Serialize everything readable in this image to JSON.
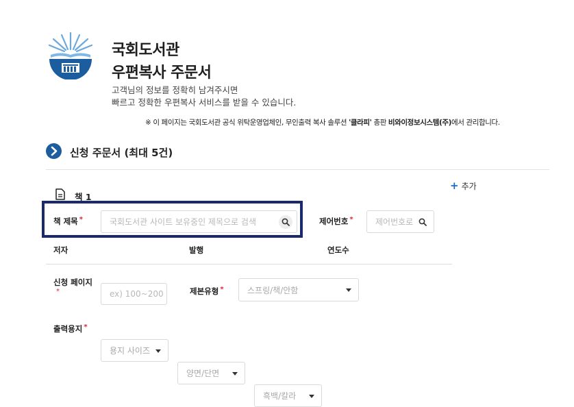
{
  "header": {
    "title_line1": "국회도서관",
    "title_line2": "우편복사 주문서",
    "desc_line1": "고객님의 정보를 정확히 남겨주시면",
    "desc_line2": "빠르고 정확한 우편복사 서비스를 받을 수 있습니다."
  },
  "notice": {
    "mark": "※",
    "text_a": "이 페이지는 국회도서관 공식 위탁운영업체인, 무인출력 복사 솔루션 ",
    "brand": "'클라피'",
    "text_b": " 총판 ",
    "company": "비와이정보시스템(주)",
    "text_c": "에서 관리합니다."
  },
  "section": {
    "title": "신청 주문서 (최대 5건)",
    "add_label": "추가"
  },
  "book": {
    "label": "책 1",
    "title_label": "책 제목",
    "title_placeholder": "국회도서관 사이트 보유중인 제목으로 검색",
    "control_label": "제어번호",
    "control_placeholder": "제어번호로",
    "author_label": "저자",
    "publisher_label": "발행",
    "year_label": "연도수",
    "pages_label_line1": "신청 페이지",
    "pages_placeholder": "ex) 100~200",
    "binding_label": "제본유형",
    "binding_value": "스프링/책/안함",
    "paper_label": "출력용지",
    "paper_size_value": "용지 사이즈",
    "sides_value": "양면/단면",
    "color_value": "흑백/칼라",
    "required_mark": "*"
  },
  "colors": {
    "brand_blue": "#1b5d9e",
    "highlight_border": "#1a2b6d",
    "required_red": "#d9263b",
    "add_blue": "#1b6ac9"
  },
  "icons": [
    "library-logo",
    "chevron-right-icon",
    "document-icon",
    "plus-icon",
    "search-icon",
    "caret-down-icon"
  ]
}
